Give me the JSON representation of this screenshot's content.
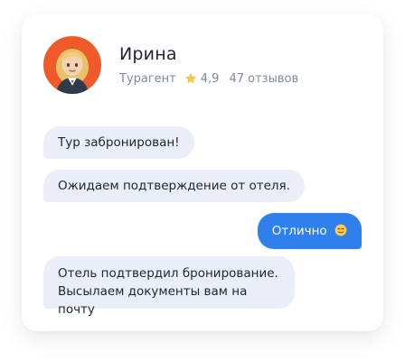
{
  "profile": {
    "name": "Ирина",
    "role": "Турагент",
    "rating": "4,9",
    "reviews": "47 отзывов",
    "avatar_icon": "woman-avatar-icon",
    "star_icon": "star-icon"
  },
  "messages": [
    {
      "direction": "incoming",
      "text": "Тур забронирован!"
    },
    {
      "direction": "incoming",
      "text": "Ожидаем подтверждение от отеля."
    },
    {
      "direction": "outgoing",
      "text": "Отлично",
      "emoji_icon": "relieved-face-icon"
    },
    {
      "direction": "incoming",
      "text": "Отель подтвердил бронирование.\nВысылаем документы вам на почту"
    }
  ],
  "colors": {
    "avatar_bg": "#ef5a2b",
    "incoming_bg": "#e9eef8",
    "outgoing_bg": "#2f80ed",
    "meta_text": "#7f899b",
    "name_text": "#1f2433"
  }
}
